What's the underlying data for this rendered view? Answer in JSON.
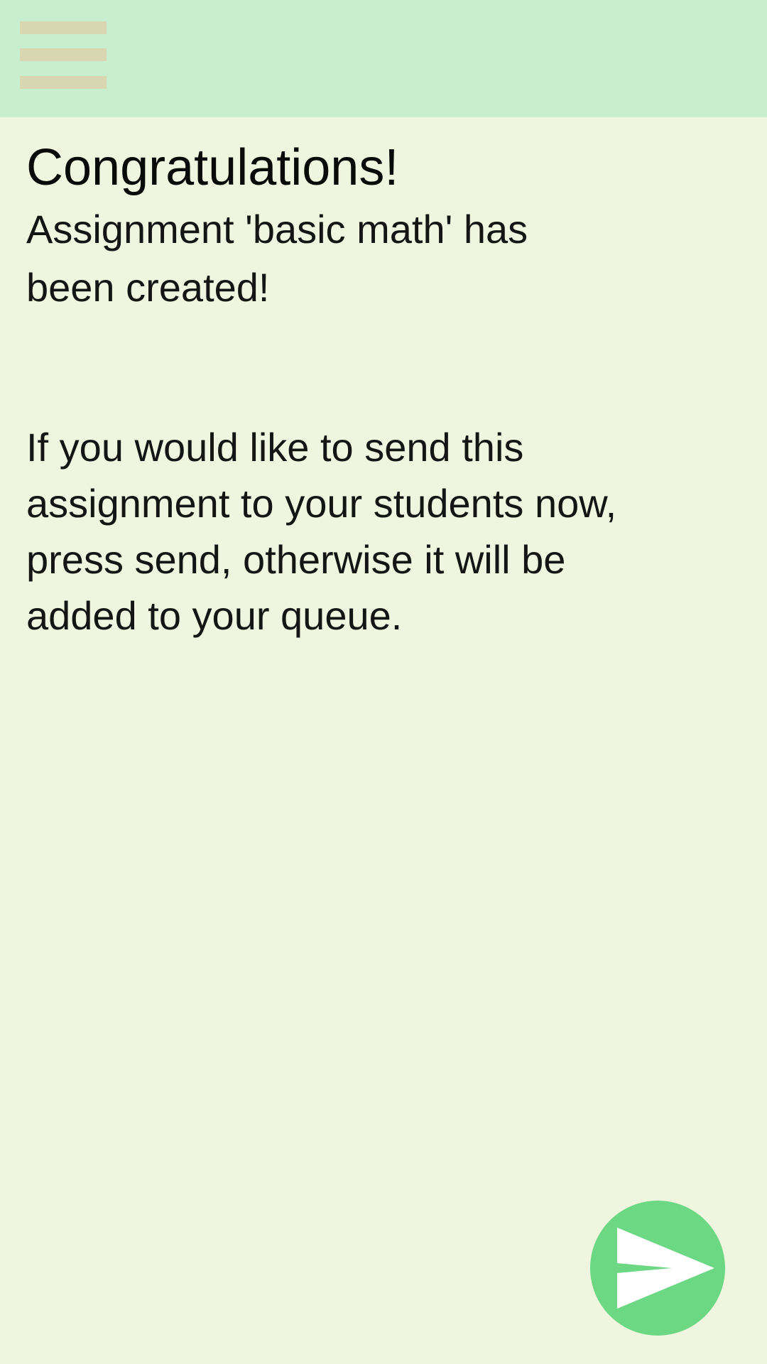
{
  "app_bar": {
    "menu_icon": "hamburger-menu-icon",
    "background_color": "#c6eecf",
    "menu_icon_color": "#d9d6b2"
  },
  "main": {
    "title": "Congratulations!",
    "message": "Assignment 'basic math' has been created!",
    "instructions": "If you would like to send this assignment to your students now, press send, otherwise it will be added to your queue.",
    "background_color": "#eff5de"
  },
  "send_button": {
    "icon": "send-icon",
    "color": "#6cd884"
  }
}
